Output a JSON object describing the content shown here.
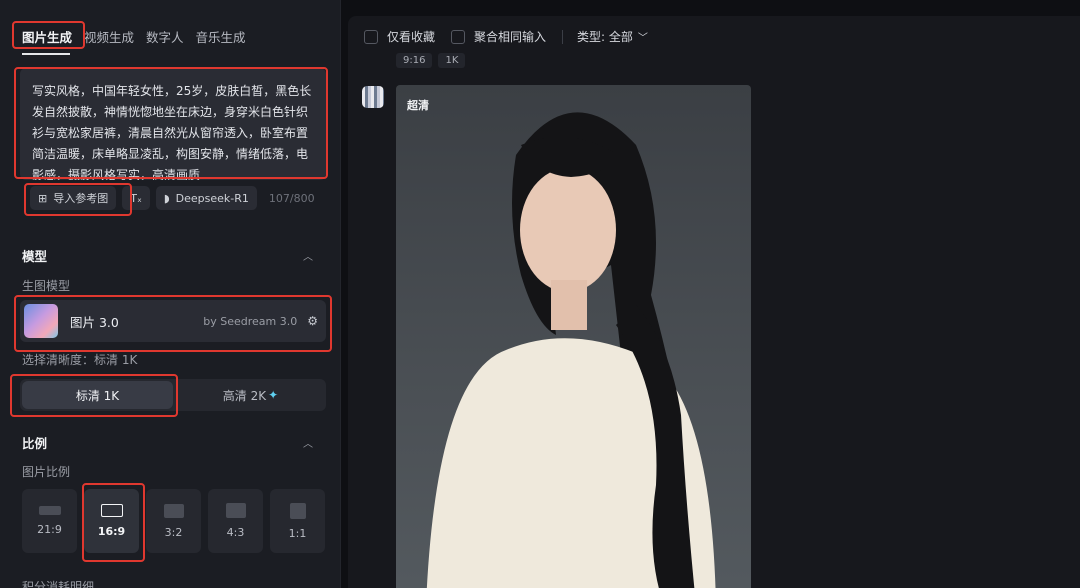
{
  "tabs": [
    "图片生成",
    "视频生成",
    "数字人",
    "音乐生成"
  ],
  "prompt": {
    "text": "写实风格，中国年轻女性，25岁，皮肤白皙，黑色长发自然披散，神情恍惚地坐在床边，身穿米白色针织衫与宽松家居裤，清晨自然光从窗帘透入，卧室布置简洁温暖，床单略显凌乱，构图安静，情绪低落，电影感，摄影风格写实，高清画质",
    "counter": "107/800"
  },
  "tools": {
    "reference_label": "导入参考图",
    "text_tool_icon": "text-format-icon",
    "model_label": "Deepseek-R1"
  },
  "model_section": {
    "title": "模型",
    "sub_label": "生图模型",
    "model_name": "图片 3.0",
    "model_by": "by Seedream 3.0",
    "resolution_label": "选择清晰度：标清 1K",
    "res_options": [
      "标清 1K",
      "高清 2K"
    ]
  },
  "ratio_section": {
    "title": "比例",
    "sub_label": "图片比例",
    "ratios": [
      "21:9",
      "16:9",
      "3:2",
      "4:3",
      "1:1"
    ],
    "selected": "16:9"
  },
  "bottom_label": "积分消耗明细",
  "filter": {
    "favorites": "仅看收藏",
    "merge": "聚合相同输入",
    "type": "类型: 全部"
  },
  "tags": [
    "9:16",
    "1K"
  ],
  "image_badge": "超清",
  "colors": {
    "highlight": "#e0382f",
    "accent_sparkle": "#5fd0f0"
  }
}
